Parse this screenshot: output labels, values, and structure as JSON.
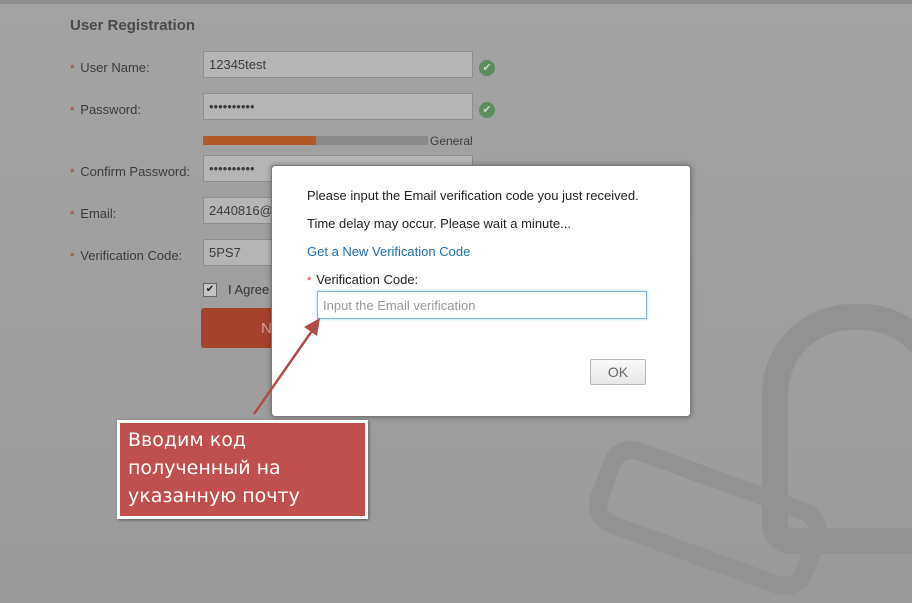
{
  "registration": {
    "title": "User Registration",
    "fields": {
      "user_name": {
        "label": "User Name:",
        "value": "12345test"
      },
      "password": {
        "label": "Password:",
        "value": "••••••••••"
      },
      "confirm_password": {
        "label": "Confirm Password:",
        "value": "••••••••••"
      },
      "email": {
        "label": "Email:",
        "value": "2440816@"
      },
      "verification_code": {
        "label": "Verification Code:",
        "value": "5PS7"
      }
    },
    "required_mark": "*",
    "ok_icon": "check-icon",
    "password_strength": {
      "label": "General",
      "fraction": 0.5
    },
    "agree_label": "I Agree",
    "agree_checked": true,
    "next_label": "N"
  },
  "dialog": {
    "line1": "Please input the Email verification code you just received.",
    "line2": "Time delay may occur. Please wait a minute...",
    "link": "Get a New Verification Code",
    "required_mark": "*",
    "field_label": "Verification Code:",
    "field_placeholder": "Input the Email verification",
    "field_value": "",
    "ok_label": "OK"
  },
  "annotation": {
    "text": "Вводим код\nполученный на\nуказанную почту",
    "color": "#c0504d",
    "arrow_color": "#b24a47"
  },
  "colors": {
    "accent_button": "#a6412e",
    "link": "#1a6fa8",
    "strength_fill": "#b05a2a"
  }
}
